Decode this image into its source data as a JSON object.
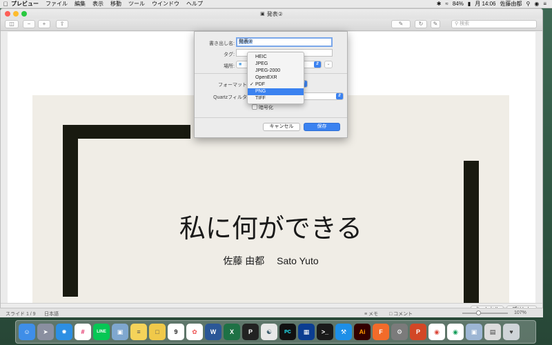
{
  "menubar": {
    "app_name": "プレビュー",
    "menus": [
      "ファイル",
      "編集",
      "表示",
      "移動",
      "ツール",
      "ウインドウ",
      "ヘルプ"
    ],
    "battery": "84%",
    "clock": "月 14:06",
    "user": "佐藤由都"
  },
  "window": {
    "title": "発表②",
    "search_placeholder": "検索"
  },
  "slide": {
    "title": "私に何ができる",
    "author": "佐藤 由都　 Sato Yuto"
  },
  "dialog": {
    "export_as_label": "書き出し名:",
    "export_as_value": "発表②",
    "tags_label": "タグ:",
    "location_label": "場所:",
    "format_label": "フォーマット",
    "quartz_label": "Quartzフィルタ",
    "encrypt_label": "暗号化",
    "cancel_label": "キャンセル",
    "save_label": "保存"
  },
  "format_menu": {
    "options": [
      "HEIC",
      "JPEG",
      "JPEG-2000",
      "OpenEXR",
      "PDF",
      "PNG",
      "TIFF"
    ],
    "checked": "PDF",
    "highlighted": "PNG"
  },
  "window_bottom": {
    "cancel_label": "キャンセル",
    "print_label": "プリント"
  },
  "statusbar": {
    "slide_info": "スライド 1 / 9",
    "language": "日本語",
    "memo": "メモ",
    "comment": "コメント",
    "zoom": "107%"
  },
  "dock": {
    "icons": [
      "finder-icon",
      "launchpad-icon",
      "safari-icon",
      "slack-icon",
      "line-icon",
      "preview-icon",
      "notes-icon",
      "stickies-icon",
      "calendar-icon",
      "photos-icon",
      "word-icon",
      "excel-icon",
      "p-app-icon",
      "python-icon",
      "pycharm-icon",
      "mirror-icon",
      "terminal-icon",
      "xcode-icon",
      "illustrator-icon",
      "figma-icon",
      "preferences-icon",
      "powerpoint-icon",
      "chrome-icon",
      "chrome2-icon",
      "photos2-icon",
      "finder2-icon",
      "trash-icon"
    ],
    "calendar_day": "9"
  }
}
